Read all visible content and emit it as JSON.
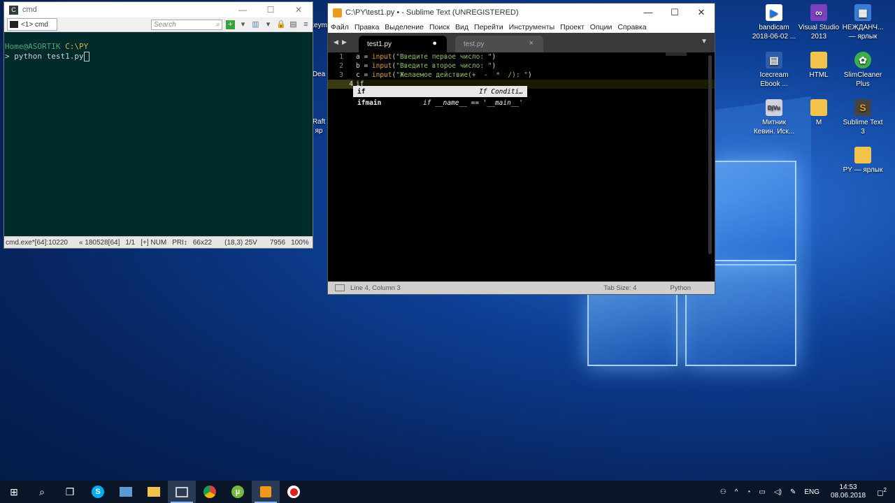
{
  "cmd": {
    "title": "cmd",
    "tab_label": "<1> cmd",
    "search_placeholder": "Search",
    "prompt_user": "Home@ASORTIK",
    "prompt_path": "C:\\PY",
    "command": "> python test1.py",
    "status": [
      "cmd.exe*[64]:10220",
      "« 180528[64]",
      "1/1",
      "[+] NUM",
      "PRI↕",
      "66x22",
      "(18,3) 25V",
      "7956",
      "100%"
    ]
  },
  "sublime": {
    "title": "C:\\PY\\test1.py • - Sublime Text (UNREGISTERED)",
    "menu": [
      "Файл",
      "Правка",
      "Выделение",
      "Поиск",
      "Вид",
      "Перейти",
      "Инструменты",
      "Проект",
      "Опции",
      "Справка"
    ],
    "tabs": [
      {
        "label": "test1.py",
        "mark": "●"
      },
      {
        "label": "test.py",
        "mark": "×"
      }
    ],
    "lines": [
      {
        "n": "1",
        "var": "a = ",
        "fn": "input",
        "open": "(",
        "str": "\"Введите первое число: \"",
        "close": ")"
      },
      {
        "n": "2",
        "var": "b = ",
        "fn": "input",
        "open": "(",
        "str": "\"Введите второе число: \"",
        "close": ")"
      },
      {
        "n": "3",
        "var": "c = ",
        "fn": "input",
        "open": "(",
        "str": "\"Желаемое действие(+  -  *  /): \"",
        "close": ")"
      },
      {
        "n": "4",
        "kw": "if"
      }
    ],
    "autocomplete": [
      {
        "trigger": "if",
        "hint": "If Conditi…"
      },
      {
        "trigger": "ifmain",
        "hint": "if __name__ == '__main__'"
      }
    ],
    "status_position": "Line 4, Column 3",
    "status_tab": "Tab Size: 4",
    "status_syntax": "Python"
  },
  "desktop_icons": [
    {
      "label": "bandicam 2018-06-02 ...",
      "icon": "bandicam-icon",
      "color": "#ffffff"
    },
    {
      "label": "Visual Studio 2013",
      "icon": "visual-studio-icon",
      "color": "#7b3fbf"
    },
    {
      "label": "НЕЖДАНЧ... — ярлык",
      "icon": "shortcut-icon",
      "color": "#3a7bd5"
    },
    {
      "label": "Icecream Ebook ...",
      "icon": "icecream-icon",
      "color": "#2e5ea8"
    },
    {
      "label": "HTML",
      "icon": "folder-icon",
      "color": "#f3c24c"
    },
    {
      "label": "SlimCleaner Plus",
      "icon": "slimcleaner-icon",
      "color": "#3fae49"
    },
    {
      "label": "Митник Кевин. Иск...",
      "icon": "djvu-icon",
      "color": "#d0d0e0"
    },
    {
      "label": "M",
      "icon": "folder-icon",
      "color": "#f3c24c"
    },
    {
      "label": "Sublime Text 3",
      "icon": "sublime-icon",
      "color": "#f09a1c"
    },
    {
      "label": "PY — ярлык",
      "icon": "folder-icon",
      "color": "#f3c24c"
    }
  ],
  "partial_icons": [
    "keym",
    "Dea",
    "Raft",
    "яр"
  ],
  "taskbar": {
    "lang": "ENG",
    "time": "14:53",
    "date": "08.06.2018",
    "notifications": "2"
  }
}
